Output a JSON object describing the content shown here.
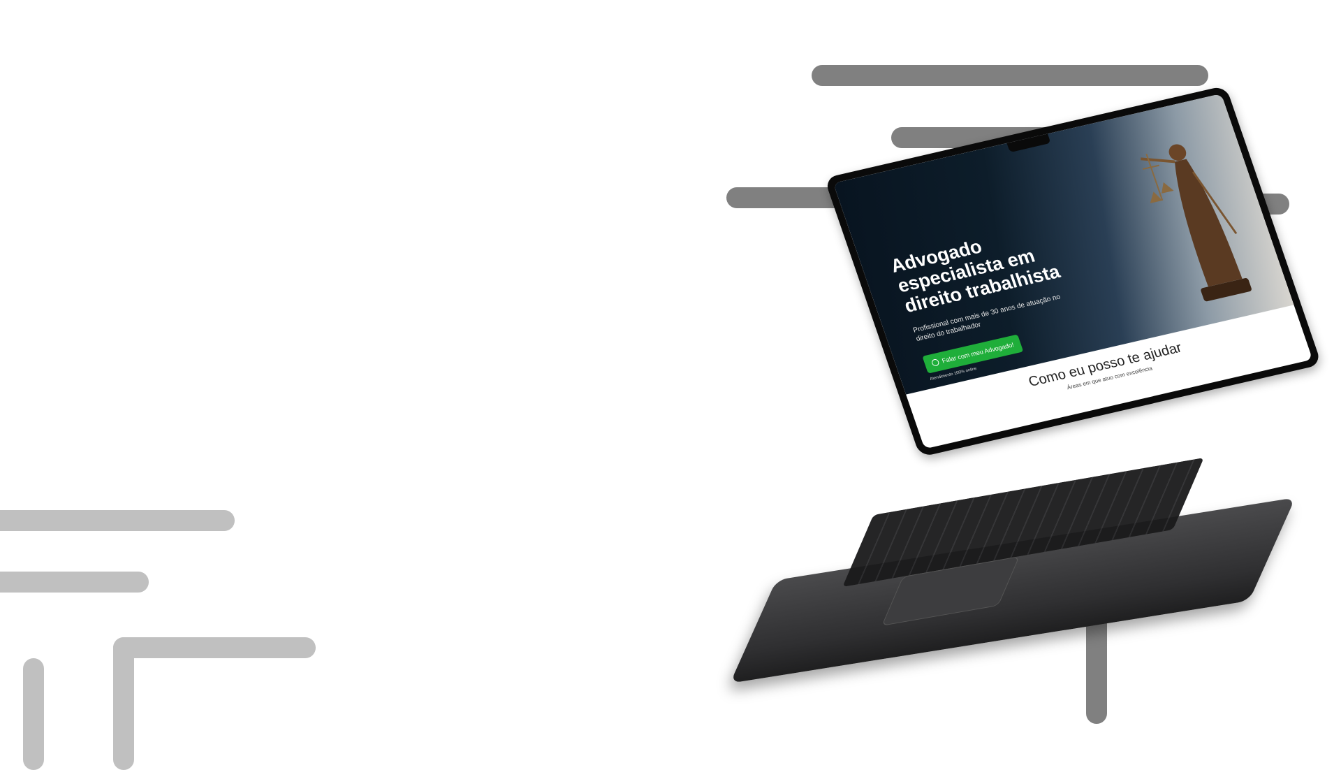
{
  "hero": {
    "title": "Advogado especialista em direito trabalhista",
    "subtitle": "Profissional com mais de 30 anos de atuação no direito do trabalhador",
    "cta_label": "Falar com meu Advogado!",
    "cta_note": "Atendimento 100% online"
  },
  "services": {
    "title": "Como eu posso te ajudar",
    "subtitle": "Áreas em que atuo com excelência"
  },
  "colors": {
    "cta": "#1fae3a",
    "dark_bar": "#808080",
    "light_bar": "#c0c0c0"
  },
  "icons": [
    "whatsapp-icon"
  ]
}
